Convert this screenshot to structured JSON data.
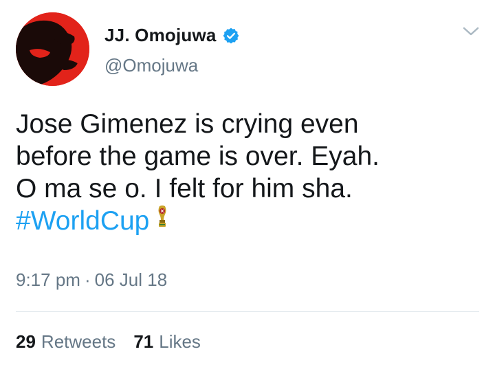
{
  "author": {
    "display_name": "JJ. Omojuwa",
    "handle": "@Omojuwa",
    "verified": true,
    "avatar_icon": "user-avatar"
  },
  "tweet": {
    "lines": [
      "Jose Gimenez is crying even",
      "before the game is over. Eyah.",
      "O ma se o. I felt for him sha."
    ],
    "hashtag": "#WorldCup",
    "hashtag_emoji_icon": "world-cup-trophy-icon"
  },
  "meta": {
    "time": "9:17 pm",
    "separator": "·",
    "date": "06 Jul 18"
  },
  "stats": {
    "retweets_count": "29",
    "retweets_label": "Retweets",
    "likes_count": "71",
    "likes_label": "Likes"
  },
  "colors": {
    "link": "#1da1f2",
    "secondary_text": "#657786",
    "primary_text": "#14171a",
    "verified_badge": "#1da1f2",
    "avatar_bg": "#e2231a"
  }
}
